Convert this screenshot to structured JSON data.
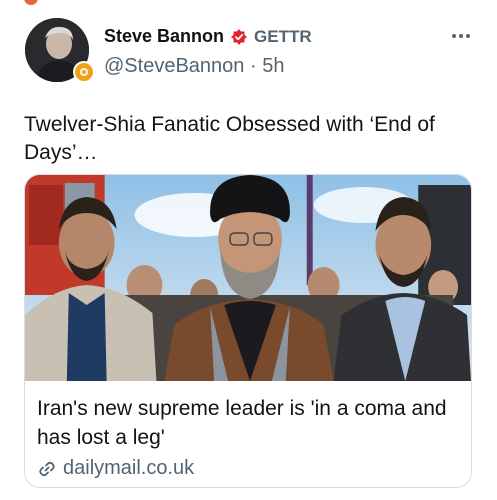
{
  "post": {
    "author_name": "Steve Bannon",
    "source_tag": "GETTR",
    "handle": "@SteveBannon",
    "separator": "·",
    "time_ago": "5h",
    "text": "Twelver-Shia Fanatic Obsessed with ‘End of Days’…"
  },
  "link_card": {
    "headline": "Iran's new supreme leader is 'in a coma and has lost a leg'",
    "domain": "dailymail.co.uk"
  },
  "icons": {
    "more": "more-horizontal-icon",
    "link": "link-icon",
    "source": "gettr-icon",
    "badge": "verified-badge-icon"
  },
  "colors": {
    "gettr_red": "#e0242b",
    "muted_text": "#536471",
    "badge_gold": "#f0a31a"
  }
}
